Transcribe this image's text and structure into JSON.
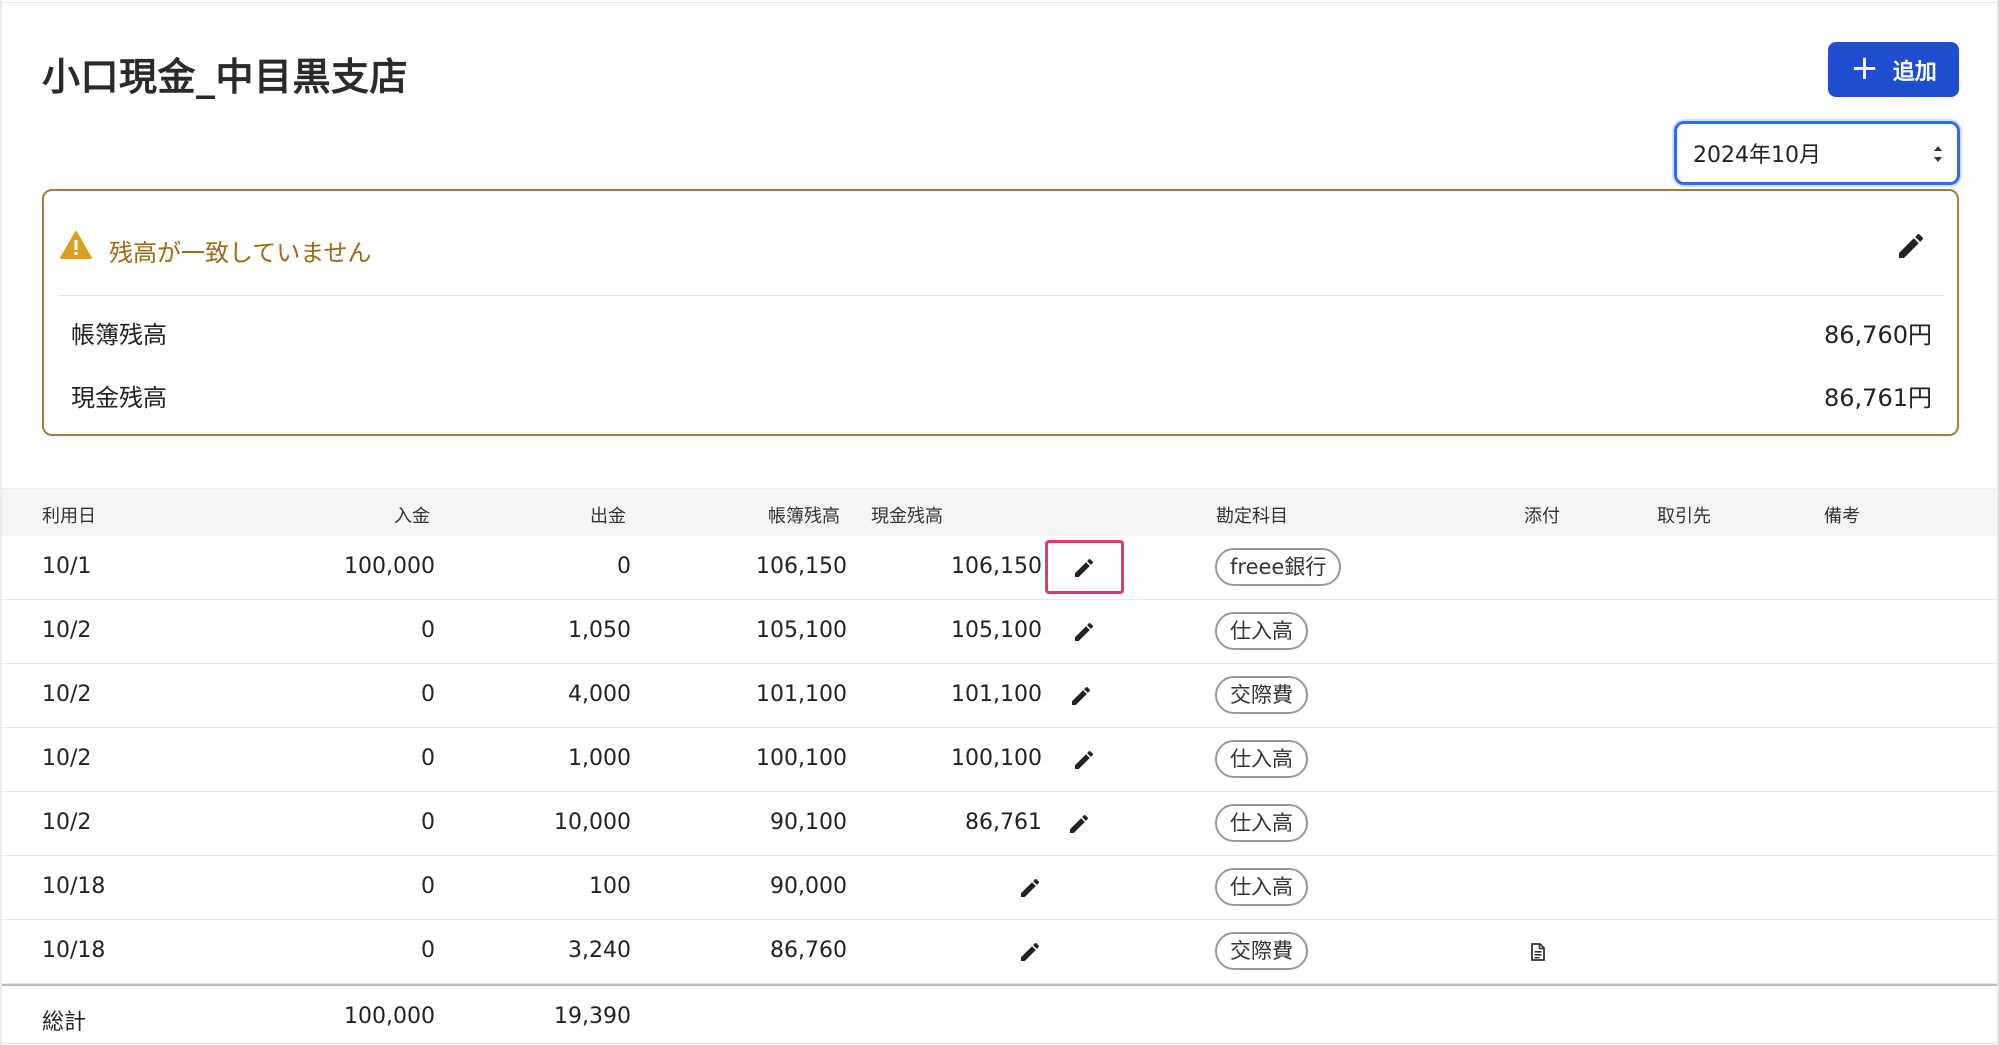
{
  "page": {
    "title": "小口現金_中目黒支店",
    "add_button_label": "追加",
    "month_select_value": "2024年10月"
  },
  "alert": {
    "message": "残高が一致していません",
    "book_balance_label": "帳簿残高",
    "book_balance_value": "86,760円",
    "cash_balance_label": "現金残高",
    "cash_balance_value": "86,761円"
  },
  "table": {
    "headers": {
      "date": "利用日",
      "deposit": "入金",
      "withdrawal": "出金",
      "book_balance": "帳簿残高",
      "cash_balance": "現金残高",
      "account": "勘定科目",
      "attachment": "添付",
      "partner": "取引先",
      "memo": "備考"
    },
    "rows": [
      {
        "date": "10/1",
        "deposit": "100,000",
        "withdrawal": "0",
        "book_balance": "106,150",
        "cash_balance": "106,150",
        "account": "freee銀行"
      },
      {
        "date": "10/2",
        "deposit": "0",
        "withdrawal": "1,050",
        "book_balance": "105,100",
        "cash_balance": "105,100",
        "account": "仕入高"
      },
      {
        "date": "10/2",
        "deposit": "0",
        "withdrawal": "4,000",
        "book_balance": "101,100",
        "cash_balance": "101,100",
        "account": "交際費"
      },
      {
        "date": "10/2",
        "deposit": "0",
        "withdrawal": "1,000",
        "book_balance": "100,100",
        "cash_balance": "100,100",
        "account": "仕入高"
      },
      {
        "date": "10/2",
        "deposit": "0",
        "withdrawal": "10,000",
        "book_balance": "90,100",
        "cash_balance": "86,761",
        "account": "仕入高"
      },
      {
        "date": "10/18",
        "deposit": "0",
        "withdrawal": "100",
        "book_balance": "90,000",
        "cash_balance": "",
        "account": "仕入高"
      },
      {
        "date": "10/18",
        "deposit": "0",
        "withdrawal": "3,240",
        "book_balance": "86,760",
        "cash_balance": "",
        "account": "交際費"
      }
    ],
    "total": {
      "label": "総計",
      "deposit": "100,000",
      "withdrawal": "19,390"
    }
  },
  "colors": {
    "primary": "#1f4fcf",
    "alert_border": "#a67c3c",
    "alert_text": "#9b6a17",
    "warning_icon": "#d9a021",
    "highlight": "#e8346b"
  },
  "icons": {
    "add": "plus-icon",
    "select": "sort-arrows-icon",
    "alert": "warning-icon",
    "edit": "pencil-icon",
    "attachment": "document-icon"
  }
}
